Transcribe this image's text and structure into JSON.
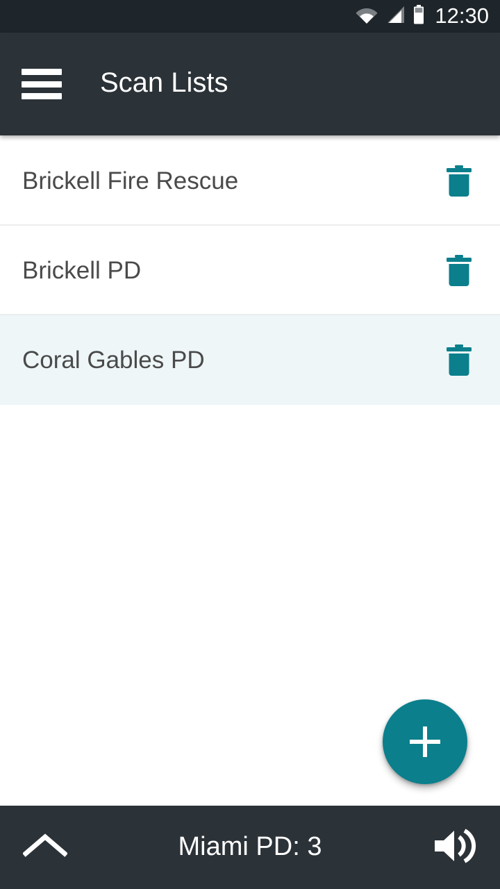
{
  "status_bar": {
    "clock": "12:30",
    "icons": [
      "wifi-icon",
      "cellular-signal-icon",
      "battery-icon"
    ],
    "background_color": "#1f262b"
  },
  "app_bar": {
    "menu_icon": "hamburger-menu-icon",
    "title": "Scan Lists",
    "background_color": "#2b3238",
    "title_color": "#ffffff"
  },
  "accent_color": "#0b7f8c",
  "selected_row_color": "#eef6f7",
  "scan_lists": {
    "rows": [
      {
        "label": "Brickell Fire Rescue",
        "selected": false,
        "delete_icon": "trash-icon"
      },
      {
        "label": "Brickell PD",
        "selected": false,
        "delete_icon": "trash-icon"
      },
      {
        "label": "Coral Gables PD",
        "selected": true,
        "delete_icon": "trash-icon"
      }
    ]
  },
  "fab": {
    "icon": "plus-icon",
    "label": "+",
    "color": "#0b7f8c"
  },
  "bottom_bar": {
    "expand_icon": "chevron-up-icon",
    "status_text": "Miami PD: 3",
    "volume_icon": "volume-up-icon",
    "background_color": "#2b3238"
  }
}
